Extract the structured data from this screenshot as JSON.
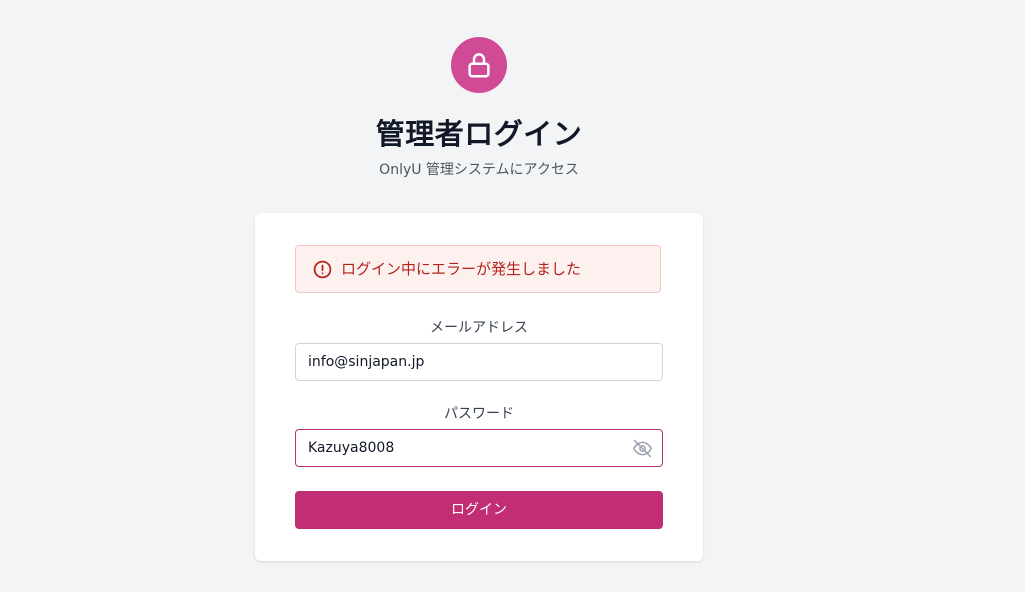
{
  "header": {
    "icon": "lock-icon",
    "title": "管理者ログイン",
    "subtitle": "OnlyU 管理システムにアクセス"
  },
  "alert": {
    "icon": "alert-circle-icon",
    "message": "ログイン中にエラーが発生しました"
  },
  "form": {
    "email": {
      "label": "メールアドレス",
      "value": "info@sinjapan.jp"
    },
    "password": {
      "label": "パスワード",
      "value": "Kazuya8008",
      "toggle_icon": "eye-off-icon"
    },
    "submit_label": "ログイン"
  },
  "colors": {
    "brand": "#c22e74",
    "lock_badge": "#d14a96",
    "error_text": "#b42318",
    "error_bg": "#fdf1f0"
  }
}
